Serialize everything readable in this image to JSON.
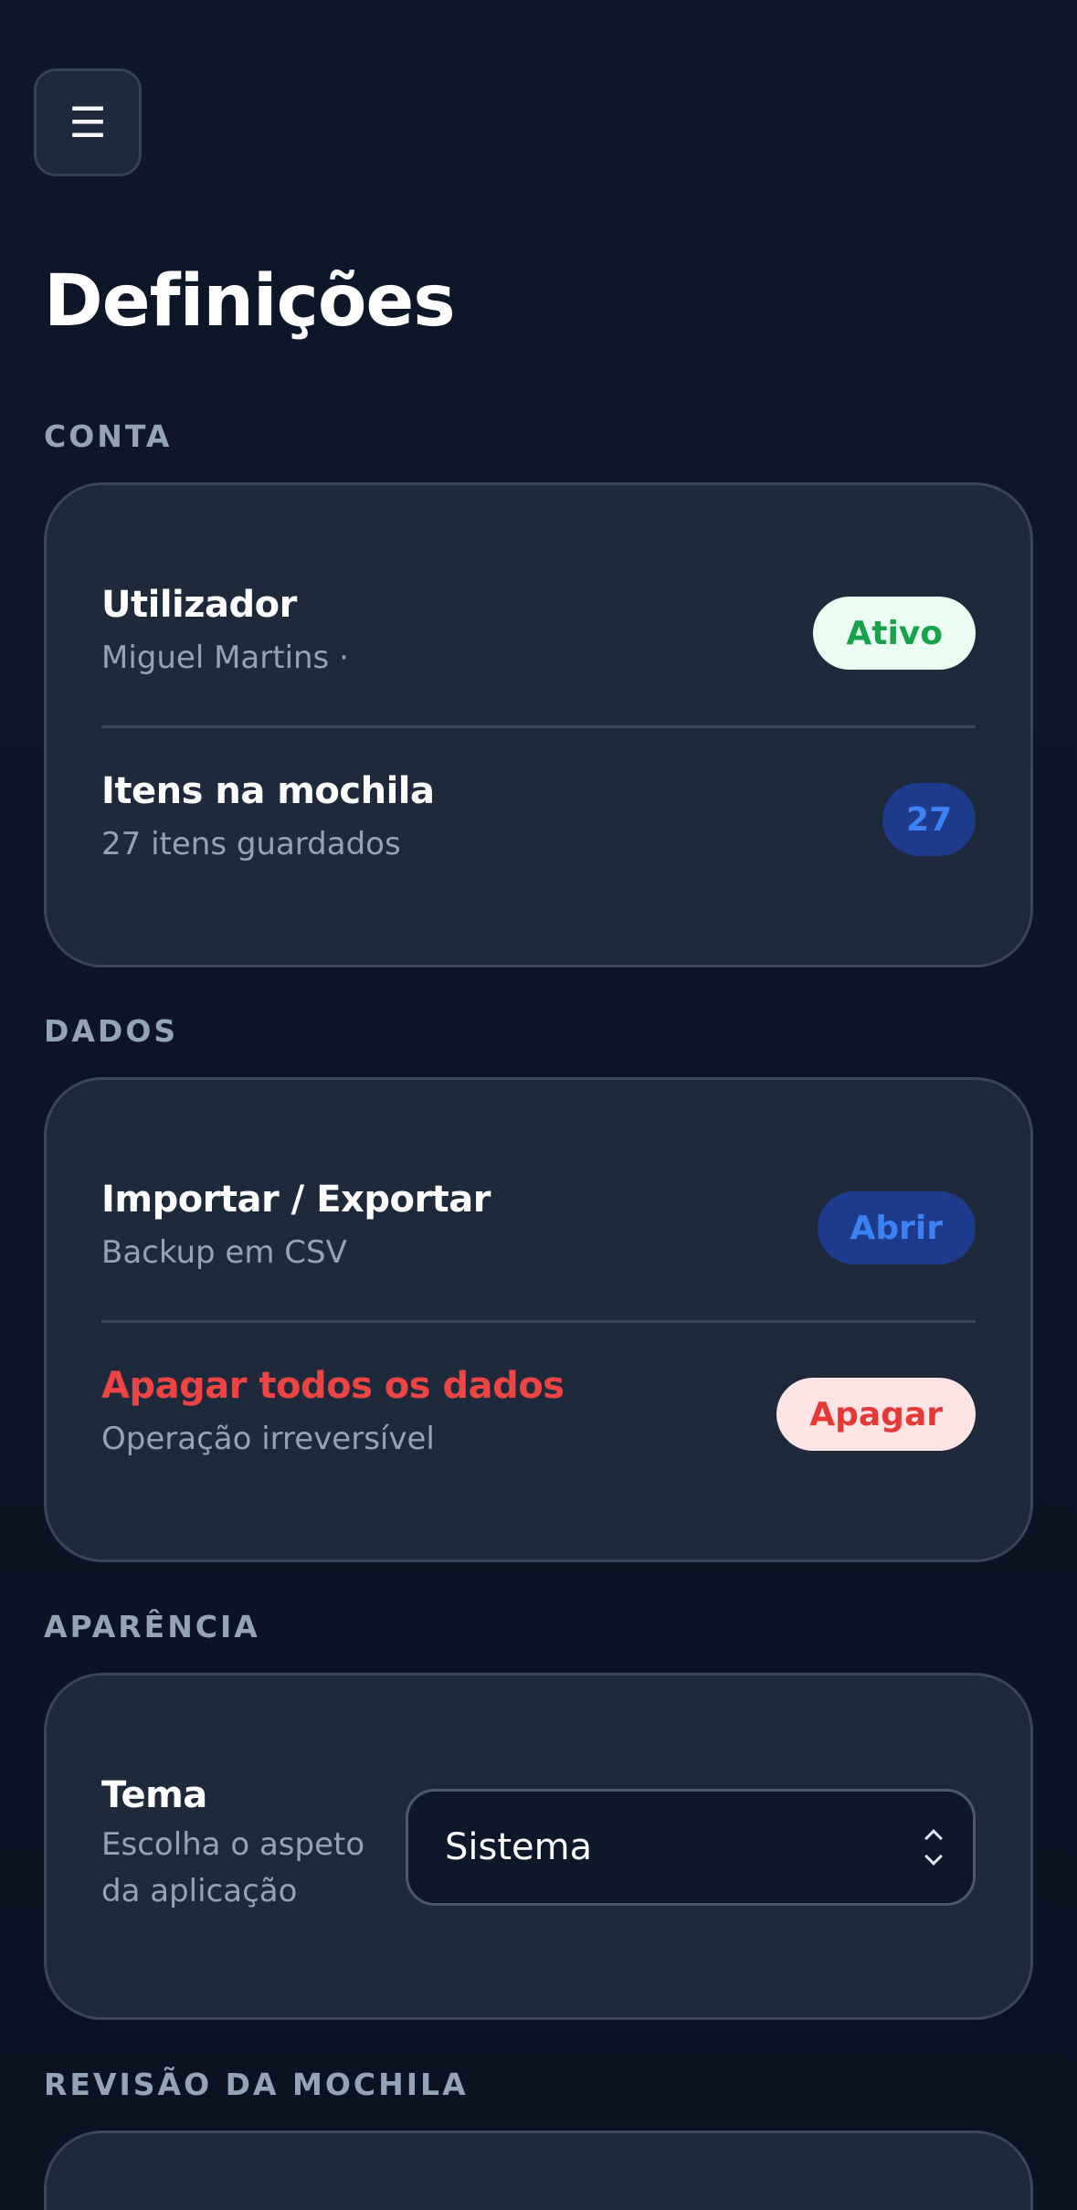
{
  "menu": {
    "icon": "☰",
    "icon_name": "hamburger-menu-icon"
  },
  "page": {
    "title": "Definições"
  },
  "sections": {
    "account": {
      "label": "CONTA"
    },
    "data": {
      "label": "DADOS"
    },
    "appearance": {
      "label": "APARÊNCIA"
    },
    "review": {
      "label": "REVISÃO DA MOCHILA"
    }
  },
  "account": {
    "user": {
      "title": "Utilizador",
      "subtitle": "Miguel Martins ·",
      "badge": "Ativo"
    },
    "items": {
      "title": "Itens na mochila",
      "subtitle": "27 itens guardados",
      "badge": "27"
    }
  },
  "data": {
    "import_export": {
      "title": "Importar / Exportar",
      "subtitle": "Backup em CSV",
      "button": "Abrir"
    },
    "delete_all": {
      "title": "Apagar todos os dados",
      "subtitle": "Operação irreversível",
      "button": "Apagar"
    }
  },
  "appearance": {
    "theme": {
      "title": "Tema",
      "subtitle_line1": "Escolha o aspeto",
      "subtitle_line2": "da aplicação",
      "selected": "Sistema"
    }
  },
  "colors": {
    "background": "#0f172a",
    "card": "#1e293b",
    "success": "#16a34a",
    "accent": "#3b82f6",
    "danger": "#ef4444"
  }
}
